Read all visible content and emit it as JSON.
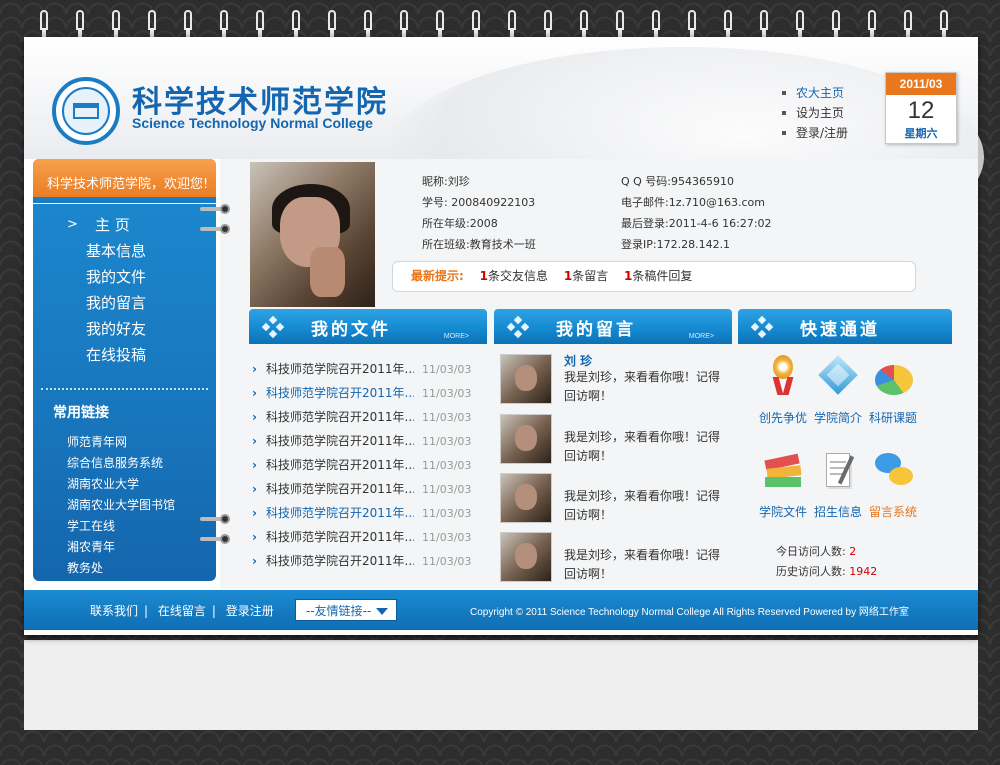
{
  "header": {
    "title_cn": "科学技术师范学院",
    "title_en": "Science Technology Normal College",
    "links": [
      "农大主页",
      "设为主页",
      "登录/注册"
    ]
  },
  "calendar": {
    "month": "2011/03",
    "day": "12",
    "weekday": "星期六"
  },
  "sidebar": {
    "welcome": "科学技术师范学院，欢迎您!",
    "nav": [
      "主  页",
      "基本信息",
      "我的文件",
      "我的留言",
      "我的好友",
      "在线投稿"
    ],
    "nav_active_marker": ">",
    "links_title": "常用链接",
    "links": [
      "师范青年网",
      "综合信息服务系统",
      "湖南农业大学",
      "湖南农业大学图书馆",
      "学工在线",
      "湘农青年",
      "教务处"
    ]
  },
  "profile": {
    "left": [
      "昵称:刘珍",
      "学号: 200840922103",
      "所在年级:2008",
      "所在班级:教育技术一班"
    ],
    "right": [
      "Q Q 号码:954365910",
      "电子邮件:1z.710@163.com",
      "最后登录:2011-4-6 16:27:02",
      "登录IP:172.28.142.1"
    ]
  },
  "tip": {
    "label": "最新提示:",
    "items": [
      {
        "n": "1",
        "text": "条交友信息"
      },
      {
        "n": "1",
        "text": "条留言"
      },
      {
        "n": "1",
        "text": "条稿件回复"
      }
    ]
  },
  "sections": {
    "files": {
      "title": "我的文件",
      "more": "MORE>"
    },
    "messages": {
      "title": "我的留言",
      "more": "MORE>"
    },
    "quick": {
      "title": "快速通道"
    }
  },
  "files": [
    {
      "title": "科技师范学院召开2011年...",
      "date": "11/03/03"
    },
    {
      "title": "科技师范学院召开2011年...",
      "date": "11/03/03"
    },
    {
      "title": "科技师范学院召开2011年...",
      "date": "11/03/03"
    },
    {
      "title": "科技师范学院召开2011年...",
      "date": "11/03/03"
    },
    {
      "title": "科技师范学院召开2011年...",
      "date": "11/03/03"
    },
    {
      "title": "科技师范学院召开2011年...",
      "date": "11/03/03"
    },
    {
      "title": "科技师范学院召开2011年...",
      "date": "11/03/03"
    },
    {
      "title": "科技师范学院召开2011年...",
      "date": "11/03/03"
    },
    {
      "title": "科技师范学院召开2011年...",
      "date": "11/03/03"
    }
  ],
  "messages": [
    {
      "name": "刘 珍",
      "text": "我是刘珍，来看看你哦！记得回访啊！"
    },
    {
      "name": "",
      "text": "我是刘珍，来看看你哦！记得回访啊！"
    },
    {
      "name": "",
      "text": "我是刘珍，来看看你哦！记得回访啊！"
    },
    {
      "name": "",
      "text": "我是刘珍，来看看你哦！记得回访啊！"
    }
  ],
  "quick": [
    {
      "label": "创先争优",
      "icon": "medal-icon"
    },
    {
      "label": "学院简介",
      "icon": "cube-icon"
    },
    {
      "label": "科研课题",
      "icon": "pie-chart-icon"
    },
    {
      "label": "学院文件",
      "icon": "books-icon"
    },
    {
      "label": "招生信息",
      "icon": "document-icon"
    },
    {
      "label": "留言系统",
      "icon": "chat-bubbles-icon"
    }
  ],
  "visits": {
    "today_label": "今日访问人数:",
    "today": "2",
    "total_label": "历史访问人数:",
    "total": "1942"
  },
  "footer": {
    "links": [
      "联系我们",
      "在线留言",
      "登录注册"
    ],
    "select": "--友情链接--",
    "copyright": "Copyright © 2011 Science Technology Normal College All Rights Reserved Powered by 网络工作室"
  },
  "colors": {
    "brand_blue": "#1466b0",
    "accent_orange": "#e8771d",
    "alert_red": "#d40000"
  }
}
